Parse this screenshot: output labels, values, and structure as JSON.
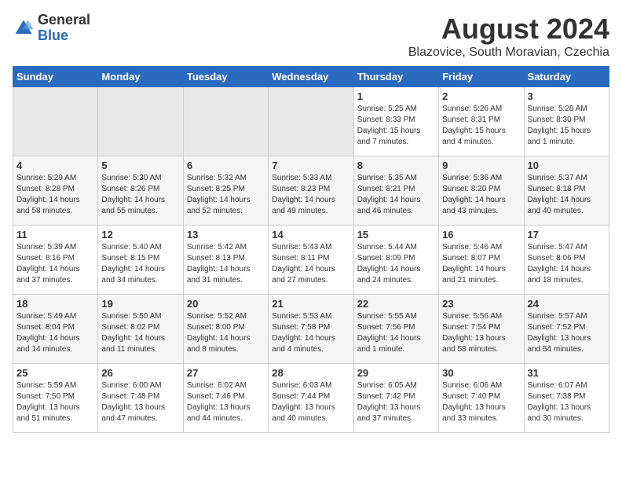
{
  "logo": {
    "general": "General",
    "blue": "Blue"
  },
  "title": "August 2024",
  "subtitle": "Blazovice, South Moravian, Czechia",
  "days_of_week": [
    "Sunday",
    "Monday",
    "Tuesday",
    "Wednesday",
    "Thursday",
    "Friday",
    "Saturday"
  ],
  "weeks": [
    [
      {
        "day": "",
        "info": ""
      },
      {
        "day": "",
        "info": ""
      },
      {
        "day": "",
        "info": ""
      },
      {
        "day": "",
        "info": ""
      },
      {
        "day": "1",
        "info": "Sunrise: 5:25 AM\nSunset: 8:33 PM\nDaylight: 15 hours and 7 minutes."
      },
      {
        "day": "2",
        "info": "Sunrise: 5:26 AM\nSunset: 8:31 PM\nDaylight: 15 hours and 4 minutes."
      },
      {
        "day": "3",
        "info": "Sunrise: 5:28 AM\nSunset: 8:30 PM\nDaylight: 15 hours and 1 minute."
      }
    ],
    [
      {
        "day": "4",
        "info": "Sunrise: 5:29 AM\nSunset: 8:28 PM\nDaylight: 14 hours and 58 minutes."
      },
      {
        "day": "5",
        "info": "Sunrise: 5:30 AM\nSunset: 8:26 PM\nDaylight: 14 hours and 55 minutes."
      },
      {
        "day": "6",
        "info": "Sunrise: 5:32 AM\nSunset: 8:25 PM\nDaylight: 14 hours and 52 minutes."
      },
      {
        "day": "7",
        "info": "Sunrise: 5:33 AM\nSunset: 8:23 PM\nDaylight: 14 hours and 49 minutes."
      },
      {
        "day": "8",
        "info": "Sunrise: 5:35 AM\nSunset: 8:21 PM\nDaylight: 14 hours and 46 minutes."
      },
      {
        "day": "9",
        "info": "Sunrise: 5:36 AM\nSunset: 8:20 PM\nDaylight: 14 hours and 43 minutes."
      },
      {
        "day": "10",
        "info": "Sunrise: 5:37 AM\nSunset: 8:18 PM\nDaylight: 14 hours and 40 minutes."
      }
    ],
    [
      {
        "day": "11",
        "info": "Sunrise: 5:39 AM\nSunset: 8:16 PM\nDaylight: 14 hours and 37 minutes."
      },
      {
        "day": "12",
        "info": "Sunrise: 5:40 AM\nSunset: 8:15 PM\nDaylight: 14 hours and 34 minutes."
      },
      {
        "day": "13",
        "info": "Sunrise: 5:42 AM\nSunset: 8:13 PM\nDaylight: 14 hours and 31 minutes."
      },
      {
        "day": "14",
        "info": "Sunrise: 5:43 AM\nSunset: 8:11 PM\nDaylight: 14 hours and 27 minutes."
      },
      {
        "day": "15",
        "info": "Sunrise: 5:44 AM\nSunset: 8:09 PM\nDaylight: 14 hours and 24 minutes."
      },
      {
        "day": "16",
        "info": "Sunrise: 5:46 AM\nSunset: 8:07 PM\nDaylight: 14 hours and 21 minutes."
      },
      {
        "day": "17",
        "info": "Sunrise: 5:47 AM\nSunset: 8:06 PM\nDaylight: 14 hours and 18 minutes."
      }
    ],
    [
      {
        "day": "18",
        "info": "Sunrise: 5:49 AM\nSunset: 8:04 PM\nDaylight: 14 hours and 14 minutes."
      },
      {
        "day": "19",
        "info": "Sunrise: 5:50 AM\nSunset: 8:02 PM\nDaylight: 14 hours and 11 minutes."
      },
      {
        "day": "20",
        "info": "Sunrise: 5:52 AM\nSunset: 8:00 PM\nDaylight: 14 hours and 8 minutes."
      },
      {
        "day": "21",
        "info": "Sunrise: 5:53 AM\nSunset: 7:58 PM\nDaylight: 14 hours and 4 minutes."
      },
      {
        "day": "22",
        "info": "Sunrise: 5:55 AM\nSunset: 7:56 PM\nDaylight: 14 hours and 1 minute."
      },
      {
        "day": "23",
        "info": "Sunrise: 5:56 AM\nSunset: 7:54 PM\nDaylight: 13 hours and 58 minutes."
      },
      {
        "day": "24",
        "info": "Sunrise: 5:57 AM\nSunset: 7:52 PM\nDaylight: 13 hours and 54 minutes."
      }
    ],
    [
      {
        "day": "25",
        "info": "Sunrise: 5:59 AM\nSunset: 7:50 PM\nDaylight: 13 hours and 51 minutes."
      },
      {
        "day": "26",
        "info": "Sunrise: 6:00 AM\nSunset: 7:48 PM\nDaylight: 13 hours and 47 minutes."
      },
      {
        "day": "27",
        "info": "Sunrise: 6:02 AM\nSunset: 7:46 PM\nDaylight: 13 hours and 44 minutes."
      },
      {
        "day": "28",
        "info": "Sunrise: 6:03 AM\nSunset: 7:44 PM\nDaylight: 13 hours and 40 minutes."
      },
      {
        "day": "29",
        "info": "Sunrise: 6:05 AM\nSunset: 7:42 PM\nDaylight: 13 hours and 37 minutes."
      },
      {
        "day": "30",
        "info": "Sunrise: 6:06 AM\nSunset: 7:40 PM\nDaylight: 13 hours and 33 minutes."
      },
      {
        "day": "31",
        "info": "Sunrise: 6:07 AM\nSunset: 7:38 PM\nDaylight: 13 hours and 30 minutes."
      }
    ]
  ]
}
